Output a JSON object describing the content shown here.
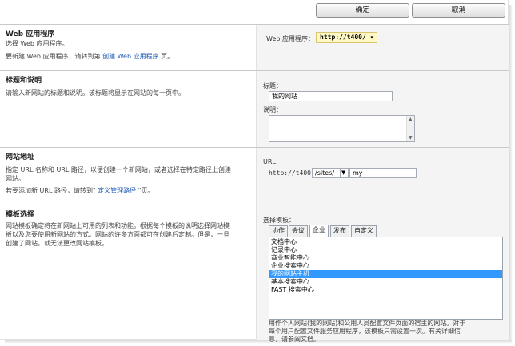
{
  "buttons": {
    "ok": "确定",
    "cancel": "取消"
  },
  "webapp_section": {
    "title": "Web 应用程序",
    "desc1": "选择 Web 应用程序。",
    "desc2_prefix": "要新建 Web 应用程序，请转到第",
    "desc2_link": "创建 Web 应用程序",
    "desc2_suffix": "页。",
    "field_label": "Web 应用程序：",
    "field_value": "http://t400/ ▾"
  },
  "title_section": {
    "title": "标题和说明",
    "desc": "请输入新网站的标题和说明。该标题将显示在网站的每一页中。",
    "title_label": "标题：",
    "title_value": "我的网站",
    "desc_label": "说明："
  },
  "url_section": {
    "title": "网站地址",
    "desc1": "指定 URL 名称和 URL 路径，以便创建一个新网站，或者选择在特定路径上创建",
    "desc1b": "网站。",
    "desc2_prefix": "若要添加新 URL 路径，请转到\"",
    "desc2_link": "定义管理路径",
    "desc2_suffix": "\"页。",
    "url_label": "URL:",
    "url_prefix": "http://t400",
    "url_path": "/sites/",
    "url_name": "my"
  },
  "template_section": {
    "title": "模板选择",
    "desc1": "网站模板确定将在新网站上可用的列表和功能。根据每个模板的说明选择网站模",
    "desc2": "板以及您要使用新网站的方式。网站的许多方面都可在创建后定制。但是，一旦",
    "desc3": "创建了网站，就无法更改网站模板。",
    "select_label": "选择模板：",
    "tabs": [
      "协作",
      "会议",
      "企业",
      "发布",
      "自定义"
    ],
    "items": [
      "文档中心",
      "记录中心",
      "商业智能中心",
      "企业搜索中心",
      "我的网站主机",
      "基本搜索中心",
      "FAST 搜索中心"
    ],
    "selected_index": 4,
    "help1": "用作个人网站(我的网站)和公用人员配置文件页面的宿主的网站。对于",
    "help2": "每个用户配置文件服务应用程序，该模板只需设置一次。有关详细信",
    "help3": "息，请参阅文档。"
  }
}
